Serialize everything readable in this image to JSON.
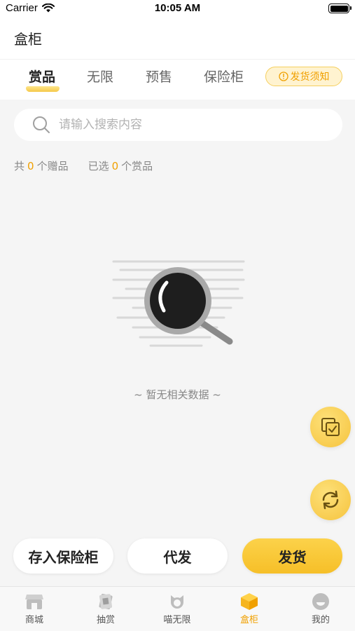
{
  "status_bar": {
    "carrier": "Carrier",
    "time": "10:05 AM"
  },
  "header": {
    "title": "盒柜"
  },
  "tabs": [
    {
      "label": "赏品",
      "active": true
    },
    {
      "label": "无限",
      "active": false
    },
    {
      "label": "预售",
      "active": false
    },
    {
      "label": "保险柜",
      "active": false
    }
  ],
  "notice_button": {
    "label": "发货须知"
  },
  "search": {
    "placeholder": "请输入搜索内容",
    "value": ""
  },
  "counts": {
    "gift_prefix": "共",
    "gift_count": "0",
    "gift_suffix": "个赠品",
    "selected_prefix": "已选",
    "selected_count": "0",
    "selected_suffix": "个赏品"
  },
  "empty_state": {
    "text": "~ 暂无相关数据 ~"
  },
  "floating_buttons": [
    {
      "icon": "select-all-icon"
    },
    {
      "icon": "refresh-icon"
    }
  ],
  "actions": {
    "safe_label": "存入保险柜",
    "proxy_label": "代发",
    "ship_label": "发货"
  },
  "bottom_nav": [
    {
      "label": "商城",
      "icon": "shop-icon",
      "active": false
    },
    {
      "label": "抽赏",
      "icon": "card-icon",
      "active": false
    },
    {
      "label": "喵无限",
      "icon": "cat-icon",
      "active": false
    },
    {
      "label": "盒柜",
      "icon": "box-icon",
      "active": true
    },
    {
      "label": "我的",
      "icon": "profile-icon",
      "active": false
    }
  ],
  "colors": {
    "accent": "#f6c33d",
    "accent_text": "#f0a000",
    "background": "#f5f5f5"
  }
}
